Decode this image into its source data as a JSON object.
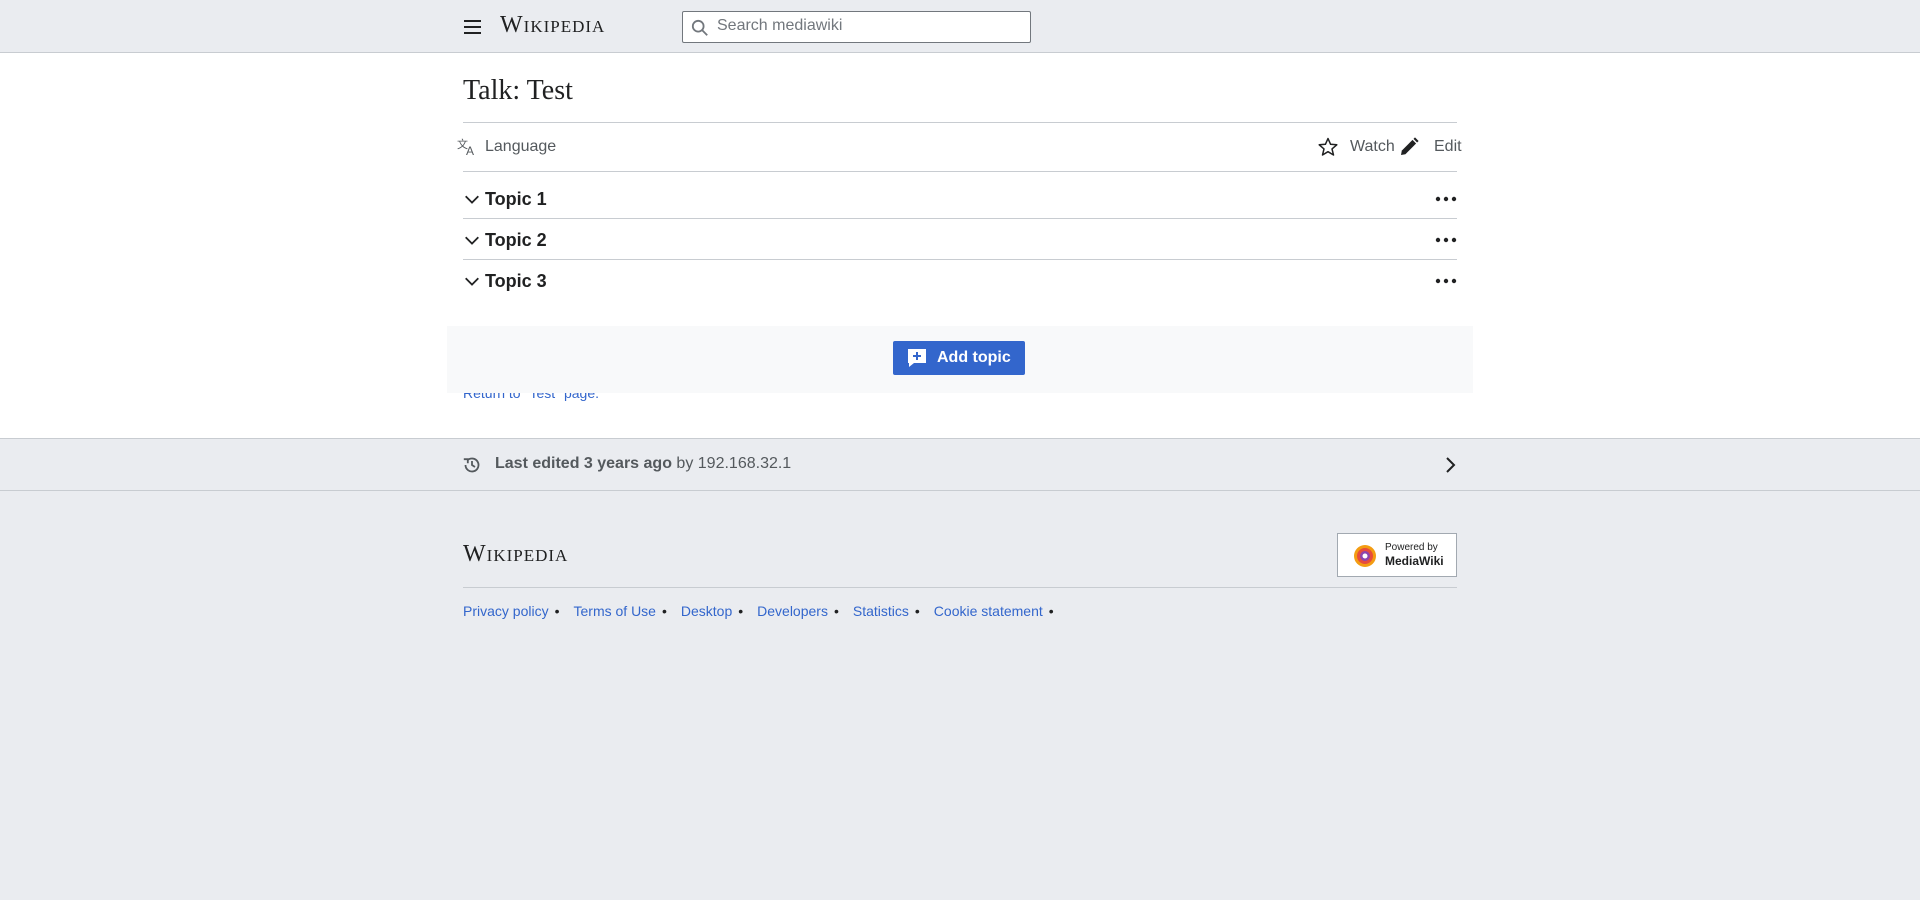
{
  "header": {
    "logo": "Wikipedia",
    "search_placeholder": "Search mediawiki"
  },
  "page": {
    "title": "Talk: Test",
    "language_label": "Language",
    "watch_label": "Watch",
    "edit_label": "Edit"
  },
  "topics": [
    {
      "label": "Topic 1"
    },
    {
      "label": "Topic 2"
    },
    {
      "label": "Topic 3"
    }
  ],
  "add_topic_label": "Add topic",
  "return_link": "Return to \"Test\" page.",
  "last_edited": {
    "prefix": "Last edited 3 years ago",
    "by": "by",
    "user": "192.168.32.1"
  },
  "footer": {
    "logo": "Wikipedia",
    "powered_by_line1": "Powered by",
    "powered_by_line2": "MediaWiki",
    "links": [
      "Privacy policy",
      "Terms of Use",
      "Desktop",
      "Developers",
      "Statistics",
      "Cookie statement"
    ]
  },
  "colors": {
    "link": "#3366cc",
    "button": "#3366cc",
    "chrome": "#eaecf0"
  }
}
